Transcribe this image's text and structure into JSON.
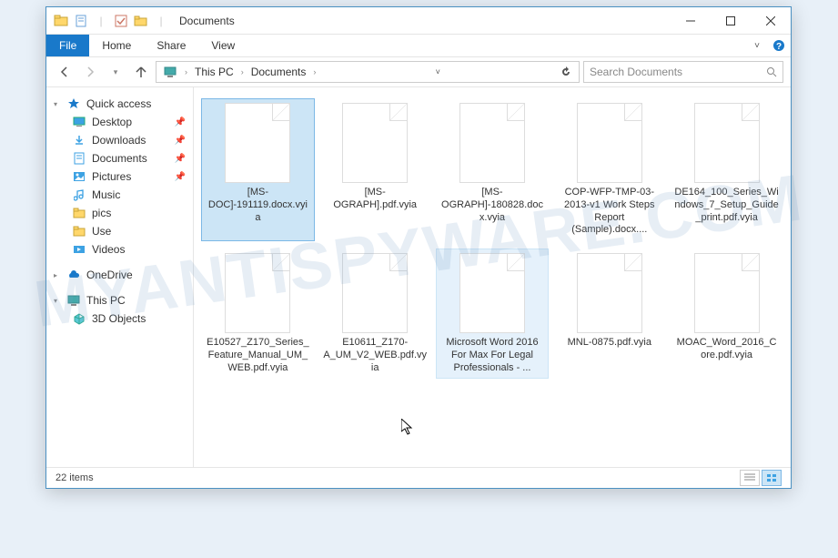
{
  "window": {
    "title": "Documents"
  },
  "ribbon": {
    "tabs": [
      {
        "label": "File",
        "active": true
      },
      {
        "label": "Home",
        "active": false
      },
      {
        "label": "Share",
        "active": false
      },
      {
        "label": "View",
        "active": false
      }
    ]
  },
  "breadcrumb": {
    "segments": [
      "This PC",
      "Documents"
    ]
  },
  "search": {
    "placeholder": "Search Documents"
  },
  "sidebar": {
    "quick_access": {
      "label": "Quick access",
      "items": [
        {
          "label": "Desktop",
          "pinned": true,
          "icon": "desktop"
        },
        {
          "label": "Downloads",
          "pinned": true,
          "icon": "downloads"
        },
        {
          "label": "Documents",
          "pinned": true,
          "icon": "documents"
        },
        {
          "label": "Pictures",
          "pinned": true,
          "icon": "pictures"
        },
        {
          "label": "Music",
          "pinned": false,
          "icon": "music"
        },
        {
          "label": "pics",
          "pinned": false,
          "icon": "folder"
        },
        {
          "label": "Use",
          "pinned": false,
          "icon": "folder"
        },
        {
          "label": "Videos",
          "pinned": false,
          "icon": "videos"
        }
      ]
    },
    "onedrive": {
      "label": "OneDrive"
    },
    "this_pc": {
      "label": "This PC",
      "items": [
        {
          "label": "3D Objects",
          "icon": "3d"
        }
      ]
    }
  },
  "files": [
    {
      "name": "[MS-DOC]-191119.docx.vyia",
      "selected": true
    },
    {
      "name": "[MS-OGRAPH].pdf.vyia",
      "selected": false
    },
    {
      "name": "[MS-OGRAPH]-180828.docx.vyia",
      "selected": false
    },
    {
      "name": "COP-WFP-TMP-03-2013-v1 Work Steps Report (Sample).docx....",
      "selected": false
    },
    {
      "name": "DE164_100_Series_Windows_7_Setup_Guide_print.pdf.vyia",
      "selected": false
    },
    {
      "name": "E10527_Z170_Series_Feature_Manual_UM_WEB.pdf.vyia",
      "selected": false
    },
    {
      "name": "E10611_Z170-A_UM_V2_WEB.pdf.vyia",
      "selected": false
    },
    {
      "name": "Microsoft Word 2016 For Max For Legal Professionals - ...",
      "selected": false,
      "hover": true
    },
    {
      "name": "MNL-0875.pdf.vyia",
      "selected": false
    },
    {
      "name": "MOAC_Word_2016_Core.pdf.vyia",
      "selected": false
    }
  ],
  "status": {
    "count_label": "22 items"
  },
  "watermark": "MYANTISPYWARE.COM"
}
